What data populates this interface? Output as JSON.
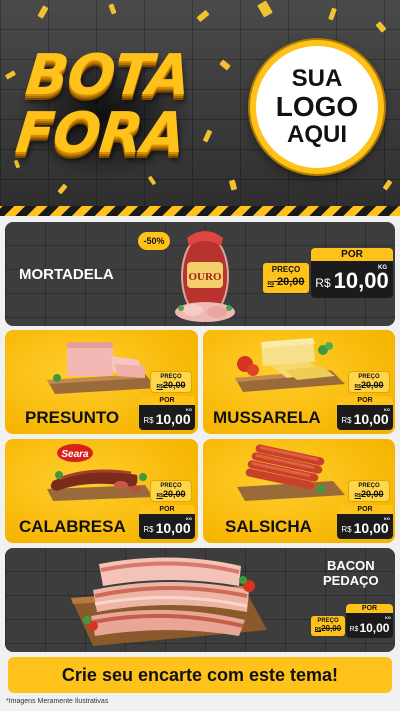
{
  "header": {
    "title_line1": "BOTA",
    "title_line2": "FORA",
    "logo_line1": "SUA",
    "logo_line2": "LOGO",
    "logo_line3": "AQUI"
  },
  "brand_colors": {
    "yellow": "#ffc21a",
    "dark": "#3d3d3d",
    "black": "#1b1b1b"
  },
  "discount_badge": "-50%",
  "products": [
    {
      "name": "MORTADELA",
      "brand_label": "OURO",
      "preco_label": "PREÇO",
      "old_price": "20,00",
      "old_currency": "R$",
      "por_label": "POR",
      "currency": "R$",
      "price": "10,00",
      "unit": "KG",
      "icon": "mortadela-image"
    },
    {
      "name": "PRESUNTO",
      "preco_label": "PREÇO",
      "old_price": "20,00",
      "old_currency": "R$",
      "por_label": "POR",
      "currency": "R$",
      "price": "10,00",
      "unit": "KG",
      "icon": "presunto-image"
    },
    {
      "name": "MUSSARELA",
      "preco_label": "PREÇO",
      "old_price": "20,00",
      "old_currency": "R$",
      "por_label": "POR",
      "currency": "R$",
      "price": "10,00",
      "unit": "KG",
      "icon": "mussarela-image"
    },
    {
      "name": "CALABRESA",
      "brand_label": "Seara",
      "preco_label": "PREÇO",
      "old_price": "20,00",
      "old_currency": "R$",
      "por_label": "POR",
      "currency": "R$",
      "price": "10,00",
      "unit": "KG",
      "icon": "calabresa-image"
    },
    {
      "name": "SALSICHA",
      "preco_label": "PREÇO",
      "old_price": "20,00",
      "old_currency": "R$",
      "por_label": "POR",
      "currency": "R$",
      "price": "10,00",
      "unit": "KG",
      "icon": "salsicha-image"
    },
    {
      "name_line1": "BACON",
      "name_line2": "PEDAÇO",
      "preco_label": "PREÇO",
      "old_price": "20,00",
      "old_currency": "R$",
      "por_label": "POR",
      "currency": "R$",
      "price": "10,00",
      "unit": "KG",
      "icon": "bacon-image"
    }
  ],
  "footer": {
    "cta": "Crie seu encarte com este tema!",
    "disclaimer": "*Imagens Meramente Ilustrativas"
  }
}
